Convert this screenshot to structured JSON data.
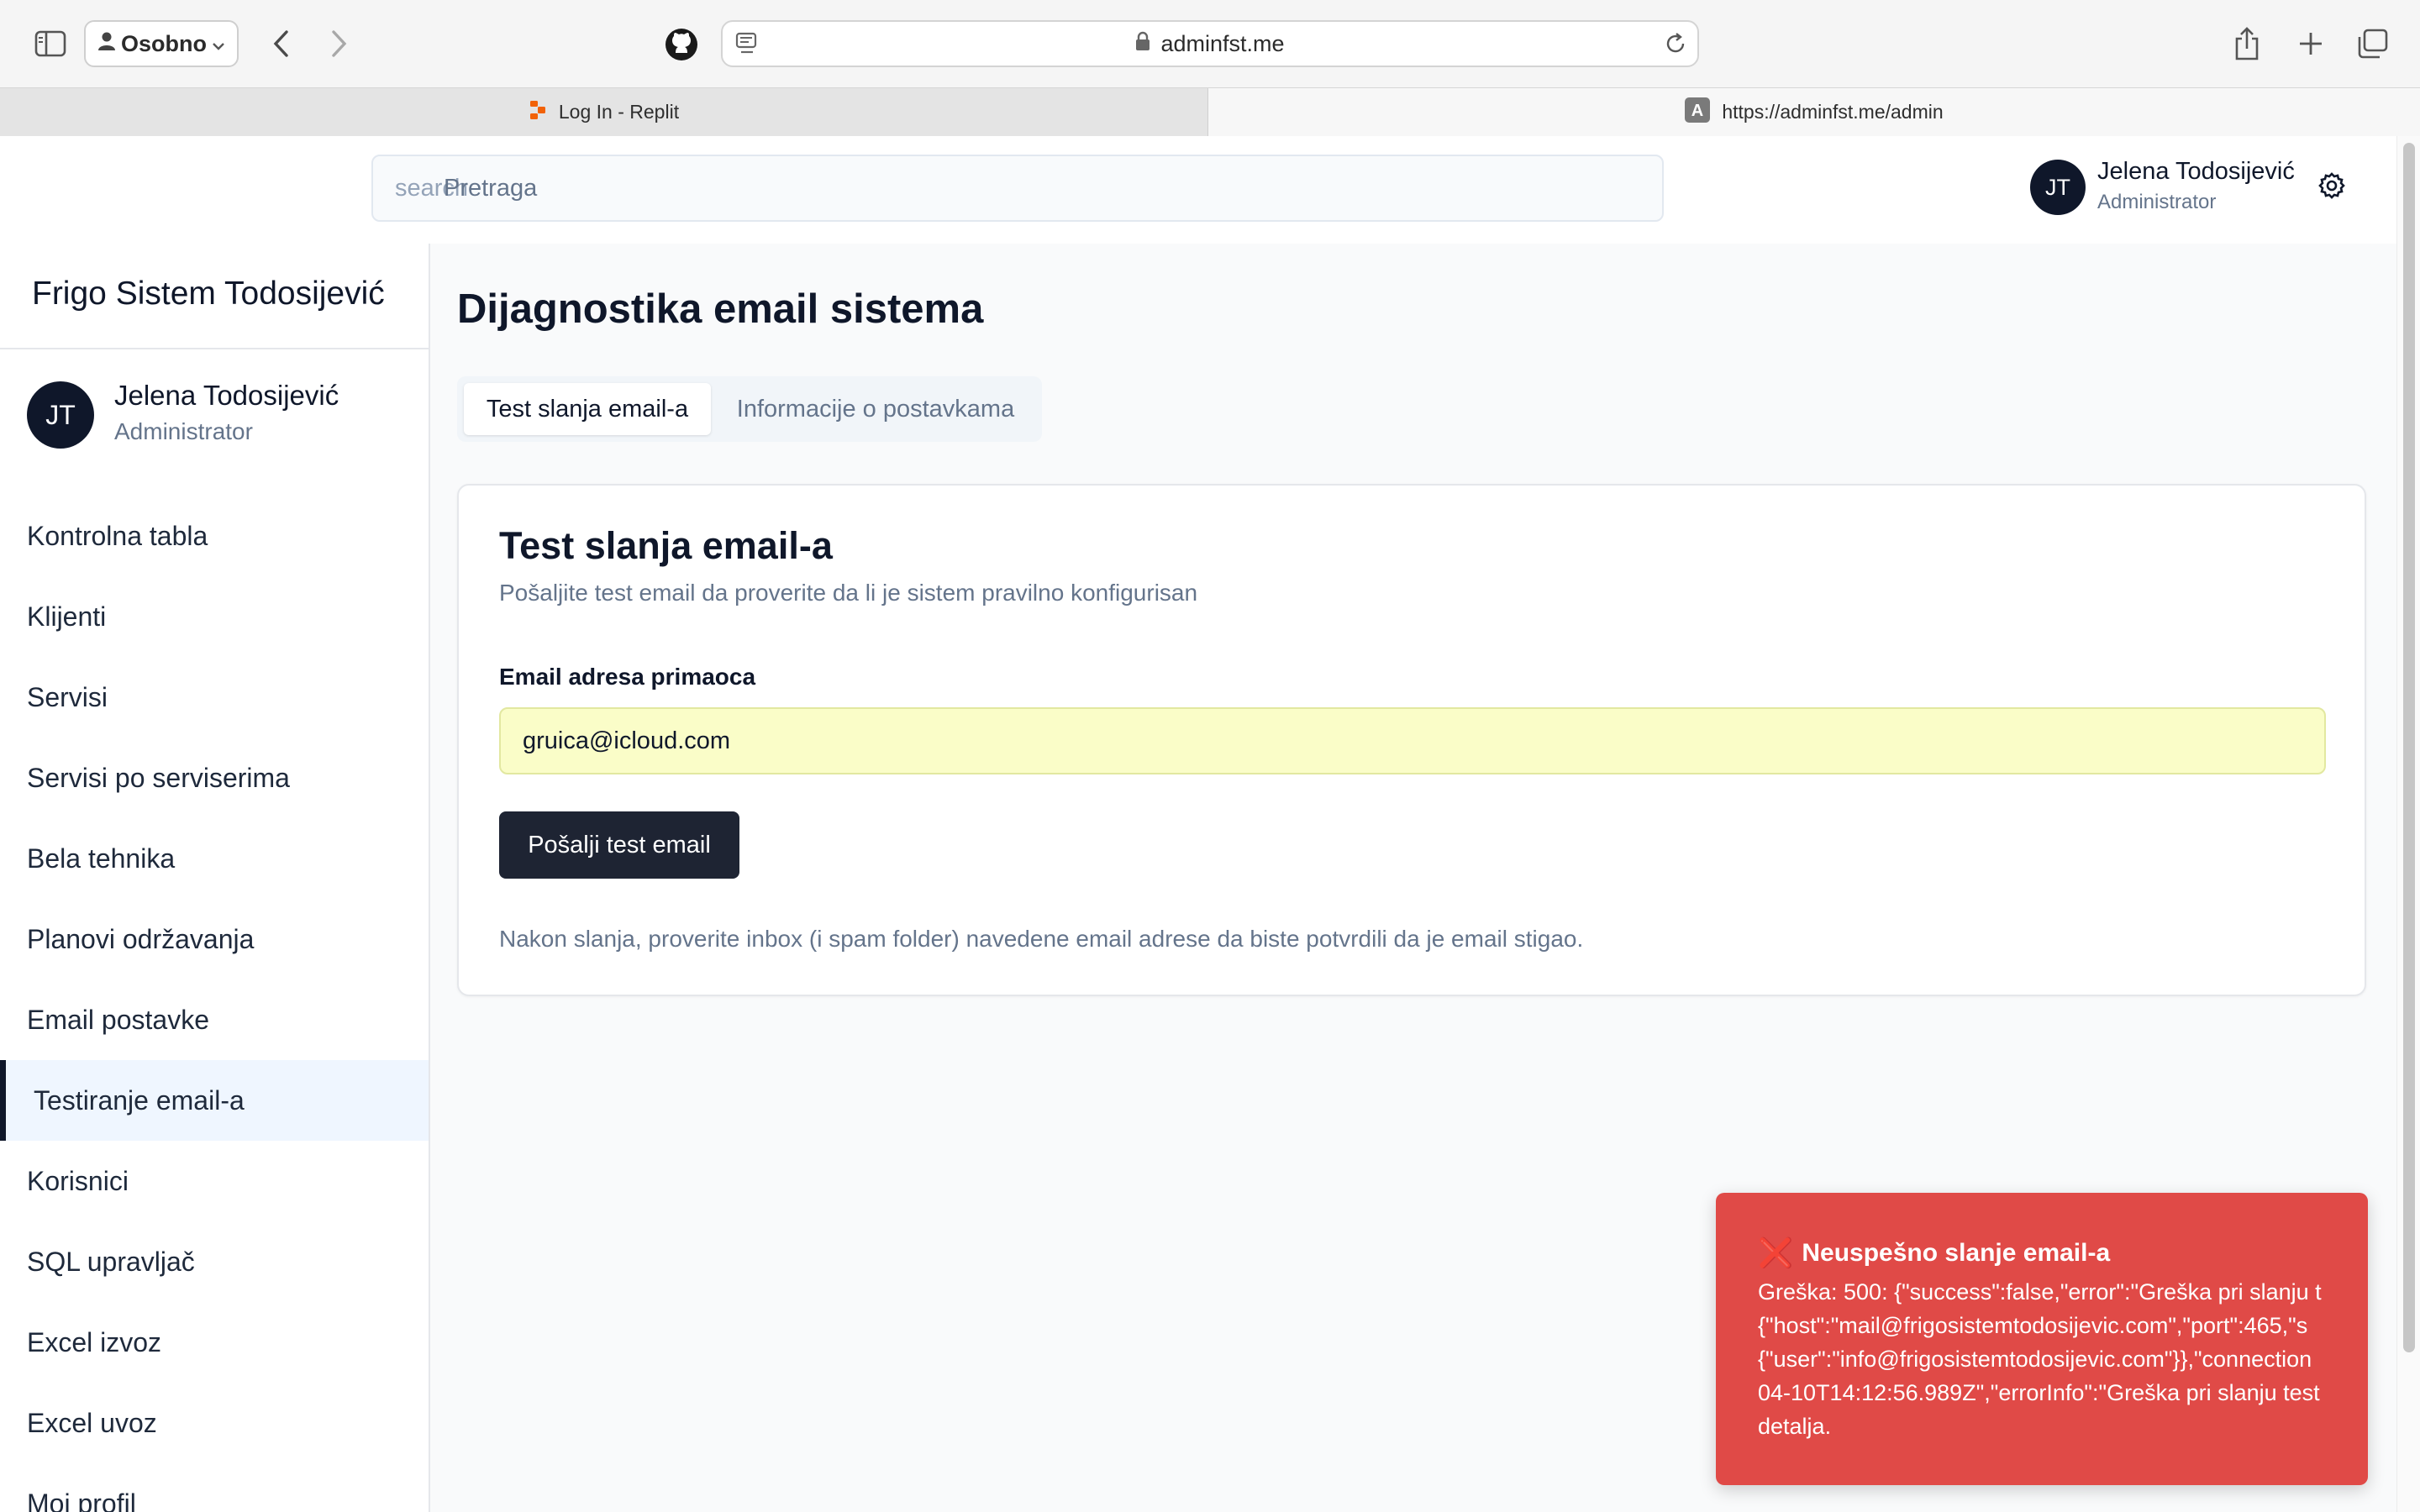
{
  "browser": {
    "profile_label": "Osobno",
    "address": "adminfst.me",
    "tabs": [
      {
        "label": "Log In - Replit"
      },
      {
        "label": "https://adminfst.me/admin"
      }
    ]
  },
  "header": {
    "search_placeholder_a": "search",
    "search_placeholder_b": "Pretraga",
    "avatar_initials": "JT",
    "user_name": "Jelena Todosijević",
    "user_role": "Administrator"
  },
  "sidebar": {
    "brand": "Frigo Sistem Todosijević",
    "avatar_initials": "JT",
    "user_name": "Jelena Todosijević",
    "user_role": "Administrator",
    "items": [
      {
        "label": "Kontrolna tabla"
      },
      {
        "label": "Klijenti"
      },
      {
        "label": "Servisi"
      },
      {
        "label": "Servisi po serviserima"
      },
      {
        "label": "Bela tehnika"
      },
      {
        "label": "Planovi održavanja"
      },
      {
        "label": "Email postavke"
      },
      {
        "label": "Testiranje email-a"
      },
      {
        "label": "Korisnici"
      },
      {
        "label": "SQL upravljač"
      },
      {
        "label": "Excel izvoz"
      },
      {
        "label": "Excel uvoz"
      },
      {
        "label": "Moj profil"
      }
    ],
    "active_index": 7
  },
  "main": {
    "title": "Dijagnostika email sistema",
    "tabs": [
      {
        "label": "Test slanja email-a"
      },
      {
        "label": "Informacije o postavkama"
      }
    ],
    "card": {
      "title": "Test slanja email-a",
      "description": "Pošaljite test email da proverite da li je sistem pravilno konfigurisan",
      "field_label": "Email adresa primaoca",
      "field_value": "gruica@icloud.com",
      "button_label": "Pošalji test email",
      "note": "Nakon slanja, proverite inbox (i spam folder) navedene email adrese da biste potvrdili da je email stigao."
    }
  },
  "toast": {
    "icon": "❌",
    "title": "Neuspešno slanje email-a",
    "lines": [
      "Greška: 500: {\"success\":false,\"error\":\"Greška pri slanju t",
      "{\"host\":\"mail@frigosistemtodosijevic.com\",\"port\":465,\"s",
      "{\"user\":\"info@frigosistemtodosijevic.com\"}},\"connection",
      "04-10T14:12:56.989Z\",\"errorInfo\":\"Greška pri slanju test",
      "detalja."
    ],
    "color": "#e04a47"
  },
  "colors": {
    "accent_dark": "#0f172a",
    "button_dark": "#1e2433",
    "active_nav_bg": "#eff6ff",
    "input_autofill_bg": "#fafdc8"
  }
}
